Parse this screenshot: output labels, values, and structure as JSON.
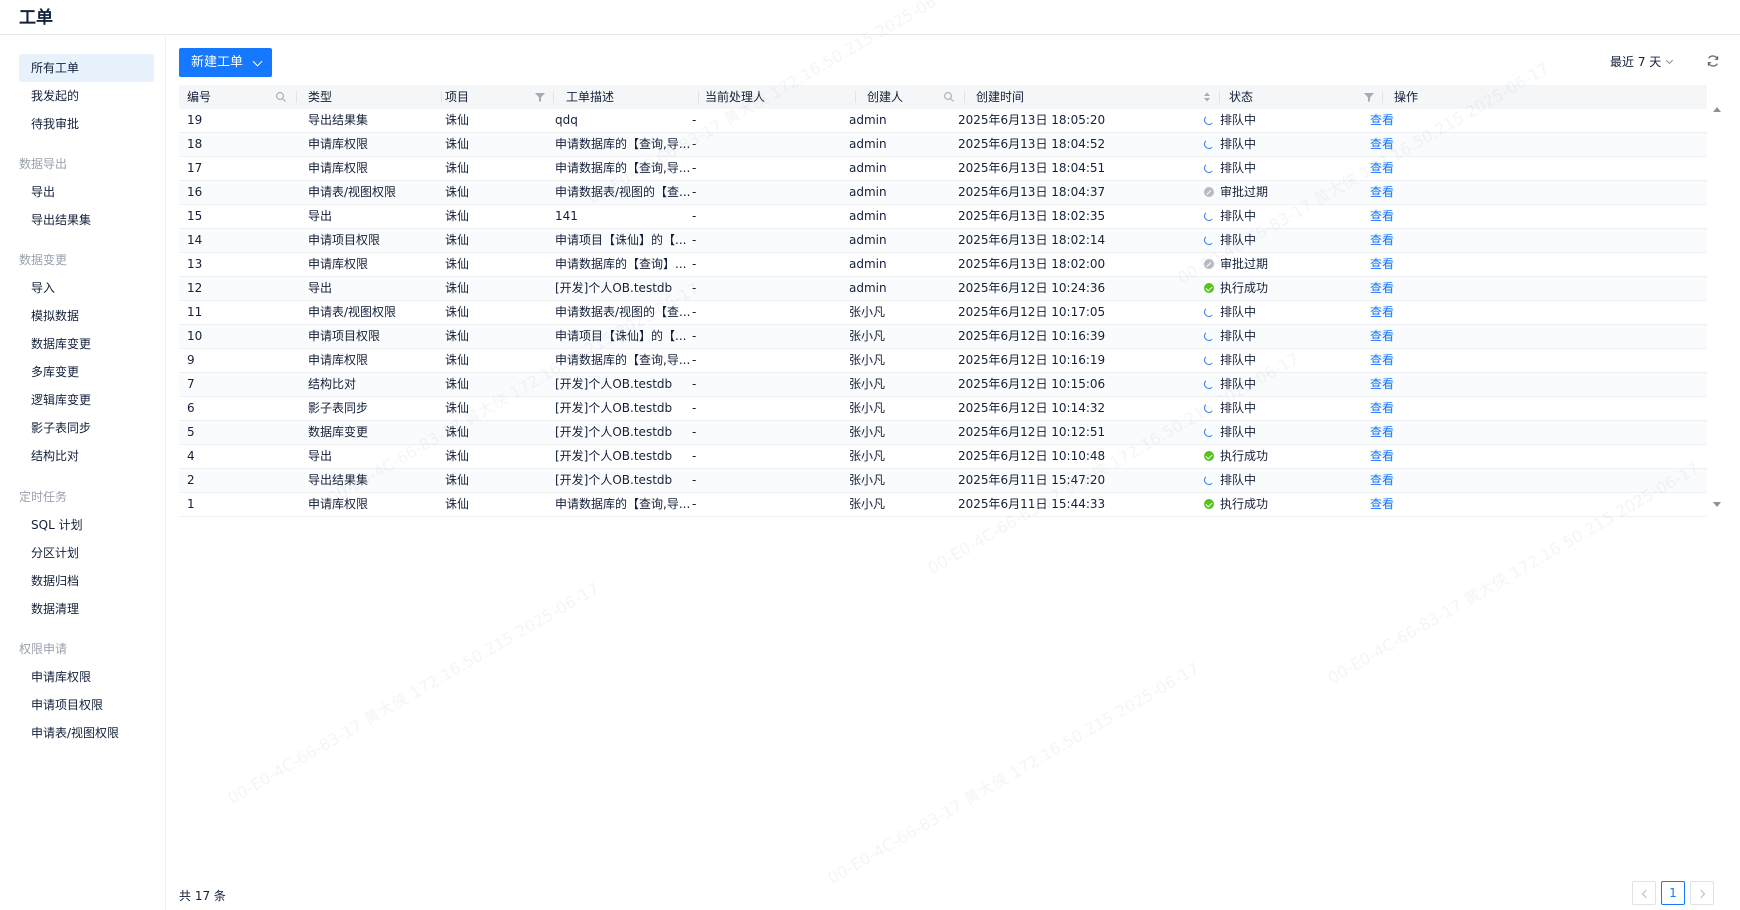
{
  "header": {
    "title": "工单"
  },
  "sidebar": {
    "top_items": [
      {
        "label": "所有工单",
        "active": true
      },
      {
        "label": "我发起的"
      },
      {
        "label": "待我审批"
      }
    ],
    "groups": [
      {
        "title": "数据导出",
        "items": [
          "导出",
          "导出结果集"
        ]
      },
      {
        "title": "数据变更",
        "items": [
          "导入",
          "模拟数据",
          "数据库变更",
          "多库变更",
          "逻辑库变更",
          "影子表同步",
          "结构比对"
        ]
      },
      {
        "title": "定时任务",
        "items": [
          "SQL 计划",
          "分区计划",
          "数据归档",
          "数据清理"
        ]
      },
      {
        "title": "权限申请",
        "items": [
          "申请库权限",
          "申请项目权限",
          "申请表/视图权限"
        ]
      }
    ]
  },
  "toolbar": {
    "new_button": "新建工单",
    "range_label": "最近 7 天"
  },
  "table": {
    "columns": [
      "编号",
      "类型",
      "项目",
      "工单描述",
      "当前处理人",
      "创建人",
      "创建时间",
      "状态",
      "操作"
    ],
    "rows": [
      {
        "id": "19",
        "type": "导出结果集",
        "project": "诛仙",
        "desc": "qdq",
        "handler": "-",
        "creator": "admin",
        "time": "2025年6月13日 18:05:20",
        "status": "排队中",
        "status_kind": "queue",
        "action": "查看"
      },
      {
        "id": "18",
        "type": "申请库权限",
        "project": "诛仙",
        "desc": "申请数据库的【查询,导...",
        "handler": "-",
        "creator": "admin",
        "time": "2025年6月13日 18:04:52",
        "status": "排队中",
        "status_kind": "queue",
        "action": "查看"
      },
      {
        "id": "17",
        "type": "申请库权限",
        "project": "诛仙",
        "desc": "申请数据库的【查询,导...",
        "handler": "-",
        "creator": "admin",
        "time": "2025年6月13日 18:04:51",
        "status": "排队中",
        "status_kind": "queue",
        "action": "查看"
      },
      {
        "id": "16",
        "type": "申请表/视图权限",
        "project": "诛仙",
        "desc": "申请数据表/视图的【查...",
        "handler": "-",
        "creator": "admin",
        "time": "2025年6月13日 18:04:37",
        "status": "审批过期",
        "status_kind": "expired",
        "action": "查看"
      },
      {
        "id": "15",
        "type": "导出",
        "project": "诛仙",
        "desc": "141",
        "handler": "-",
        "creator": "admin",
        "time": "2025年6月13日 18:02:35",
        "status": "排队中",
        "status_kind": "queue",
        "action": "查看"
      },
      {
        "id": "14",
        "type": "申请项目权限",
        "project": "诛仙",
        "desc": "申请项目【诛仙】的【...",
        "handler": "-",
        "creator": "admin",
        "time": "2025年6月13日 18:02:14",
        "status": "排队中",
        "status_kind": "queue",
        "action": "查看"
      },
      {
        "id": "13",
        "type": "申请库权限",
        "project": "诛仙",
        "desc": "申请数据库的【查询】...",
        "handler": "-",
        "creator": "admin",
        "time": "2025年6月13日 18:02:00",
        "status": "审批过期",
        "status_kind": "expired",
        "action": "查看"
      },
      {
        "id": "12",
        "type": "导出",
        "project": "诛仙",
        "desc": "[开发]个人OB.testdb",
        "handler": "-",
        "creator": "admin",
        "time": "2025年6月12日 10:24:36",
        "status": "执行成功",
        "status_kind": "ok",
        "action": "查看"
      },
      {
        "id": "11",
        "type": "申请表/视图权限",
        "project": "诛仙",
        "desc": "申请数据表/视图的【查...",
        "handler": "-",
        "creator": "张小凡",
        "time": "2025年6月12日 10:17:05",
        "status": "排队中",
        "status_kind": "queue",
        "action": "查看"
      },
      {
        "id": "10",
        "type": "申请项目权限",
        "project": "诛仙",
        "desc": "申请项目【诛仙】的【...",
        "handler": "-",
        "creator": "张小凡",
        "time": "2025年6月12日 10:16:39",
        "status": "排队中",
        "status_kind": "queue",
        "action": "查看"
      },
      {
        "id": "9",
        "type": "申请库权限",
        "project": "诛仙",
        "desc": "申请数据库的【查询,导...",
        "handler": "-",
        "creator": "张小凡",
        "time": "2025年6月12日 10:16:19",
        "status": "排队中",
        "status_kind": "queue",
        "action": "查看"
      },
      {
        "id": "7",
        "type": "结构比对",
        "project": "诛仙",
        "desc": "[开发]个人OB.testdb",
        "handler": "-",
        "creator": "张小凡",
        "time": "2025年6月12日 10:15:06",
        "status": "排队中",
        "status_kind": "queue",
        "action": "查看"
      },
      {
        "id": "6",
        "type": "影子表同步",
        "project": "诛仙",
        "desc": "[开发]个人OB.testdb",
        "handler": "-",
        "creator": "张小凡",
        "time": "2025年6月12日 10:14:32",
        "status": "排队中",
        "status_kind": "queue",
        "action": "查看"
      },
      {
        "id": "5",
        "type": "数据库变更",
        "project": "诛仙",
        "desc": "[开发]个人OB.testdb",
        "handler": "-",
        "creator": "张小凡",
        "time": "2025年6月12日 10:12:51",
        "status": "排队中",
        "status_kind": "queue",
        "action": "查看"
      },
      {
        "id": "4",
        "type": "导出",
        "project": "诛仙",
        "desc": "[开发]个人OB.testdb",
        "handler": "-",
        "creator": "张小凡",
        "time": "2025年6月12日 10:10:48",
        "status": "执行成功",
        "status_kind": "ok",
        "action": "查看"
      },
      {
        "id": "2",
        "type": "导出结果集",
        "project": "诛仙",
        "desc": "[开发]个人OB.testdb",
        "handler": "-",
        "creator": "张小凡",
        "time": "2025年6月11日 15:47:20",
        "status": "排队中",
        "status_kind": "queue",
        "action": "查看"
      },
      {
        "id": "1",
        "type": "申请库权限",
        "project": "诛仙",
        "desc": "申请数据库的【查询,导...",
        "handler": "-",
        "creator": "张小凡",
        "time": "2025年6月11日 15:44:33",
        "status": "执行成功",
        "status_kind": "ok",
        "action": "查看"
      }
    ]
  },
  "footer": {
    "total": "共 17 条",
    "current_page": "1"
  },
  "watermark": "00-E0-4C-66-83-17  黄大侠  172.16.50.215  2025-06-17",
  "colors": {
    "accent": "#1677ff",
    "success": "#52c41a",
    "expired": "#b6bbc4"
  },
  "icons": {
    "search": "search-icon",
    "filter": "filter-icon",
    "sort": "sort-icon",
    "refresh": "refresh-icon"
  }
}
